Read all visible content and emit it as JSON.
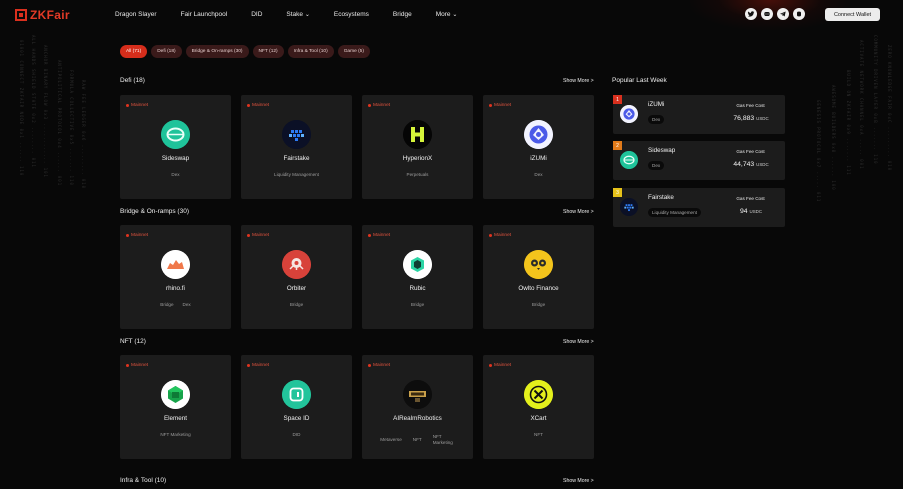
{
  "brand": {
    "name": "ZKFair"
  },
  "nav": {
    "items": [
      {
        "label": "Dragon Slayer"
      },
      {
        "label": "Fair Launchpool"
      },
      {
        "label": "DID"
      },
      {
        "label": "Stake",
        "has_dropdown": true
      },
      {
        "label": "Ecosystems"
      },
      {
        "label": "Bridge"
      },
      {
        "label": "More",
        "has_dropdown": true
      }
    ],
    "chevron": "⌄",
    "social_icons": [
      "twitter-icon",
      "discord-icon",
      "telegram-icon",
      "medium-icon"
    ],
    "connect_label": "Connect Wallet"
  },
  "filters": [
    {
      "label": "All (71)",
      "active": true
    },
    {
      "label": "Defi (18)"
    },
    {
      "label": "Bridge & On-ramps (30)"
    },
    {
      "label": "NFT (12)"
    },
    {
      "label": "Infra & Tool (10)"
    },
    {
      "label": "Game (5)"
    }
  ],
  "show_more_label": "Show More >",
  "sections": [
    {
      "title": "Defi (18)",
      "cards": [
        {
          "badge": "Mainnet",
          "name": "Sideswap",
          "tags": [
            "Dex"
          ],
          "icon": "sideswap-icon"
        },
        {
          "badge": "Mainnet",
          "name": "Fairstake",
          "tags": [
            "Liquidity Management"
          ],
          "icon": "fairstake-icon"
        },
        {
          "badge": "Mainnet",
          "name": "HyperionX",
          "tags": [
            "Perpetuals"
          ],
          "icon": "hyperionx-icon"
        },
        {
          "badge": "Mainnet",
          "name": "iZUMi",
          "tags": [
            "Dex"
          ],
          "icon": "izumi-icon"
        }
      ]
    },
    {
      "title": "Bridge & On-ramps (30)",
      "cards": [
        {
          "badge": "Mainnet",
          "name": "rhino.fi",
          "tags": [
            "Bridge",
            "Dex"
          ],
          "icon": "rhino-icon"
        },
        {
          "badge": "Mainnet",
          "name": "Orbiter",
          "tags": [
            "Bridge"
          ],
          "icon": "orbiter-icon"
        },
        {
          "badge": "Mainnet",
          "name": "Rubic",
          "tags": [
            "Bridge"
          ],
          "icon": "rubic-icon"
        },
        {
          "badge": "Mainnet",
          "name": "Owlto Finance",
          "tags": [
            "Bridge"
          ],
          "icon": "owlto-icon"
        }
      ]
    },
    {
      "title": "NFT (12)",
      "cards": [
        {
          "badge": "Mainnet",
          "name": "Element",
          "tags": [
            "NFT Marketing"
          ],
          "icon": "element-icon"
        },
        {
          "badge": "Mainnet",
          "name": "Space ID",
          "tags": [
            "DID"
          ],
          "icon": "spaceid-icon"
        },
        {
          "badge": "Mainnet",
          "name": "AIRealmRobotics",
          "tags": [
            "Metaverse",
            "NFT",
            "NFT Marketing"
          ],
          "icon": "airealm-icon"
        },
        {
          "badge": "Mainnet",
          "name": "XCart",
          "tags": [
            "NFT"
          ],
          "icon": "xcart-icon"
        }
      ]
    },
    {
      "title": "Infra & Tool (10)",
      "cards": []
    }
  ],
  "popular": {
    "title": "Popular Last Week",
    "gas_label": "Gas Fee Cost",
    "unit": "USDC",
    "items": [
      {
        "rank": "1",
        "name": "iZUMi",
        "tag": "Dex",
        "gas": "76,883",
        "rank_color": "#d9301e",
        "icon": "izumi-icon"
      },
      {
        "rank": "2",
        "name": "Sideswap",
        "tag": "Dex",
        "gas": "44,743",
        "rank_color": "#e07a1a",
        "icon": "sideswap-icon"
      },
      {
        "rank": "3",
        "name": "Fairstake",
        "tag": "Liquidity Management",
        "gas": "94",
        "rank_color": "#e6c21a",
        "icon": "fairstake-icon"
      }
    ]
  }
}
